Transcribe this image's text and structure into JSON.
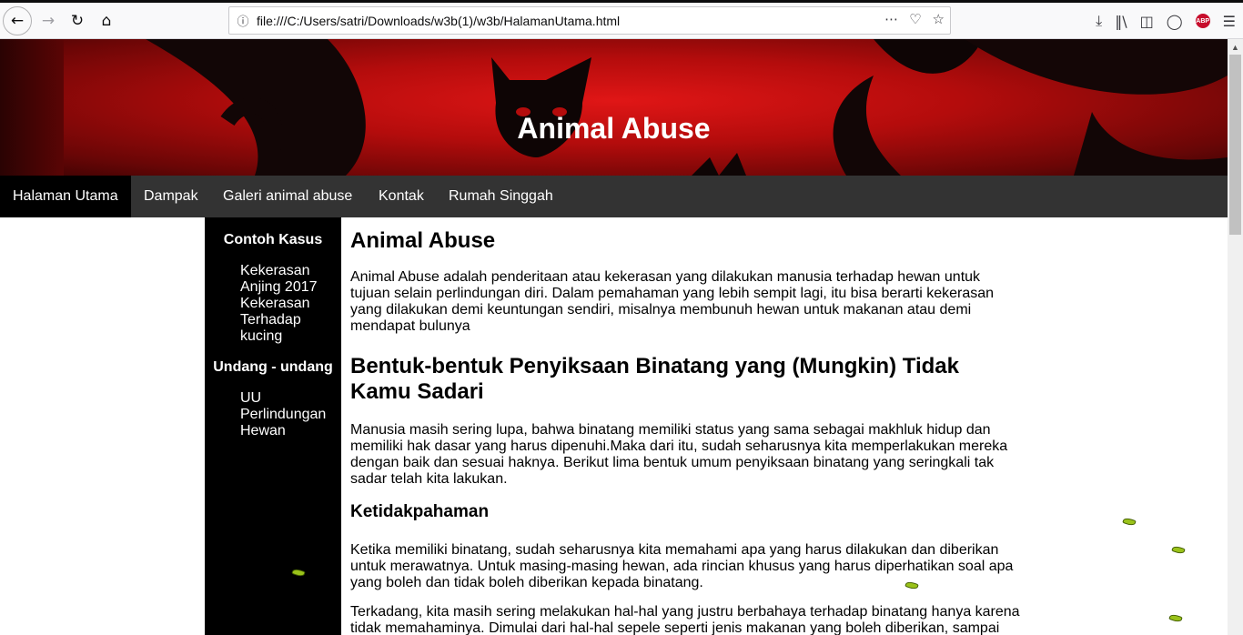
{
  "browser": {
    "url": "file:///C:/Users/satri/Downloads/w3b(1)/w3b/HalamanUtama.html",
    "icons": [
      "back-icon",
      "forward-icon",
      "reload-icon",
      "home-icon",
      "info-icon",
      "more-icon",
      "pocket-icon",
      "bookmark-star-icon",
      "download-icon",
      "library-icon",
      "sidebar-icon",
      "account-icon",
      "adblock-icon",
      "menu-icon"
    ],
    "abp_label": "ABP"
  },
  "header": {
    "title": "Animal Abuse"
  },
  "nav": {
    "items": [
      {
        "label": "Halaman Utama",
        "active": true
      },
      {
        "label": "Dampak"
      },
      {
        "label": "Galeri animal abuse"
      },
      {
        "label": "Kontak"
      },
      {
        "label": "Rumah Singgah"
      }
    ]
  },
  "sidebar": {
    "section1": {
      "title": "Contoh Kasus",
      "items": [
        "Kekerasan Anjing 2017",
        "Kekerasan Terhadap kucing"
      ]
    },
    "section2": {
      "title": "Undang - undang",
      "items": [
        "UU Perlindungan Hewan"
      ]
    }
  },
  "content": {
    "h1": "Animal Abuse",
    "p1": "Animal Abuse adalah penderitaan atau kekerasan yang dilakukan manusia terhadap hewan untuk tujuan selain perlindungan diri. Dalam pemahaman yang lebih sempit lagi, itu bisa berarti kekerasan yang dilakukan demi keuntungan sendiri, misalnya membunuh hewan untuk makanan atau demi mendapat bulunya",
    "h2": "Bentuk-bentuk Penyiksaan Binatang yang (Mungkin) Tidak Kamu Sadari",
    "p2": "Manusia masih sering lupa, bahwa binatang memiliki status yang sama sebagai makhluk hidup dan memiliki hak dasar yang harus dipenuhi.Maka dari itu, sudah seharusnya kita memperlakukan mereka dengan baik dan sesuai haknya. Berikut lima bentuk umum penyiksaan binatang yang seringkali tak sadar telah kita lakukan.",
    "h3": "Ketidakpahaman",
    "p3": "Ketika memiliki binatang, sudah seharusnya kita memahami apa yang harus dilakukan dan diberikan untuk merawatnya. Untuk masing-masing hewan, ada rincian khusus yang harus diperhatikan soal apa yang boleh dan tidak boleh diberikan kepada binatang.",
    "p4": "Terkadang, kita masih sering melakukan hal-hal yang justru berbahaya terhadap binatang hanya karena tidak memahaminya. Dimulai dari hal-hal sepele seperti jenis makanan yang boleh diberikan, sampai"
  },
  "colors": {
    "navbar": "#333333",
    "active_nav": "#000000",
    "sidebar": "#000000",
    "header_red": "#c81010",
    "leaf": "#9ac21a"
  }
}
